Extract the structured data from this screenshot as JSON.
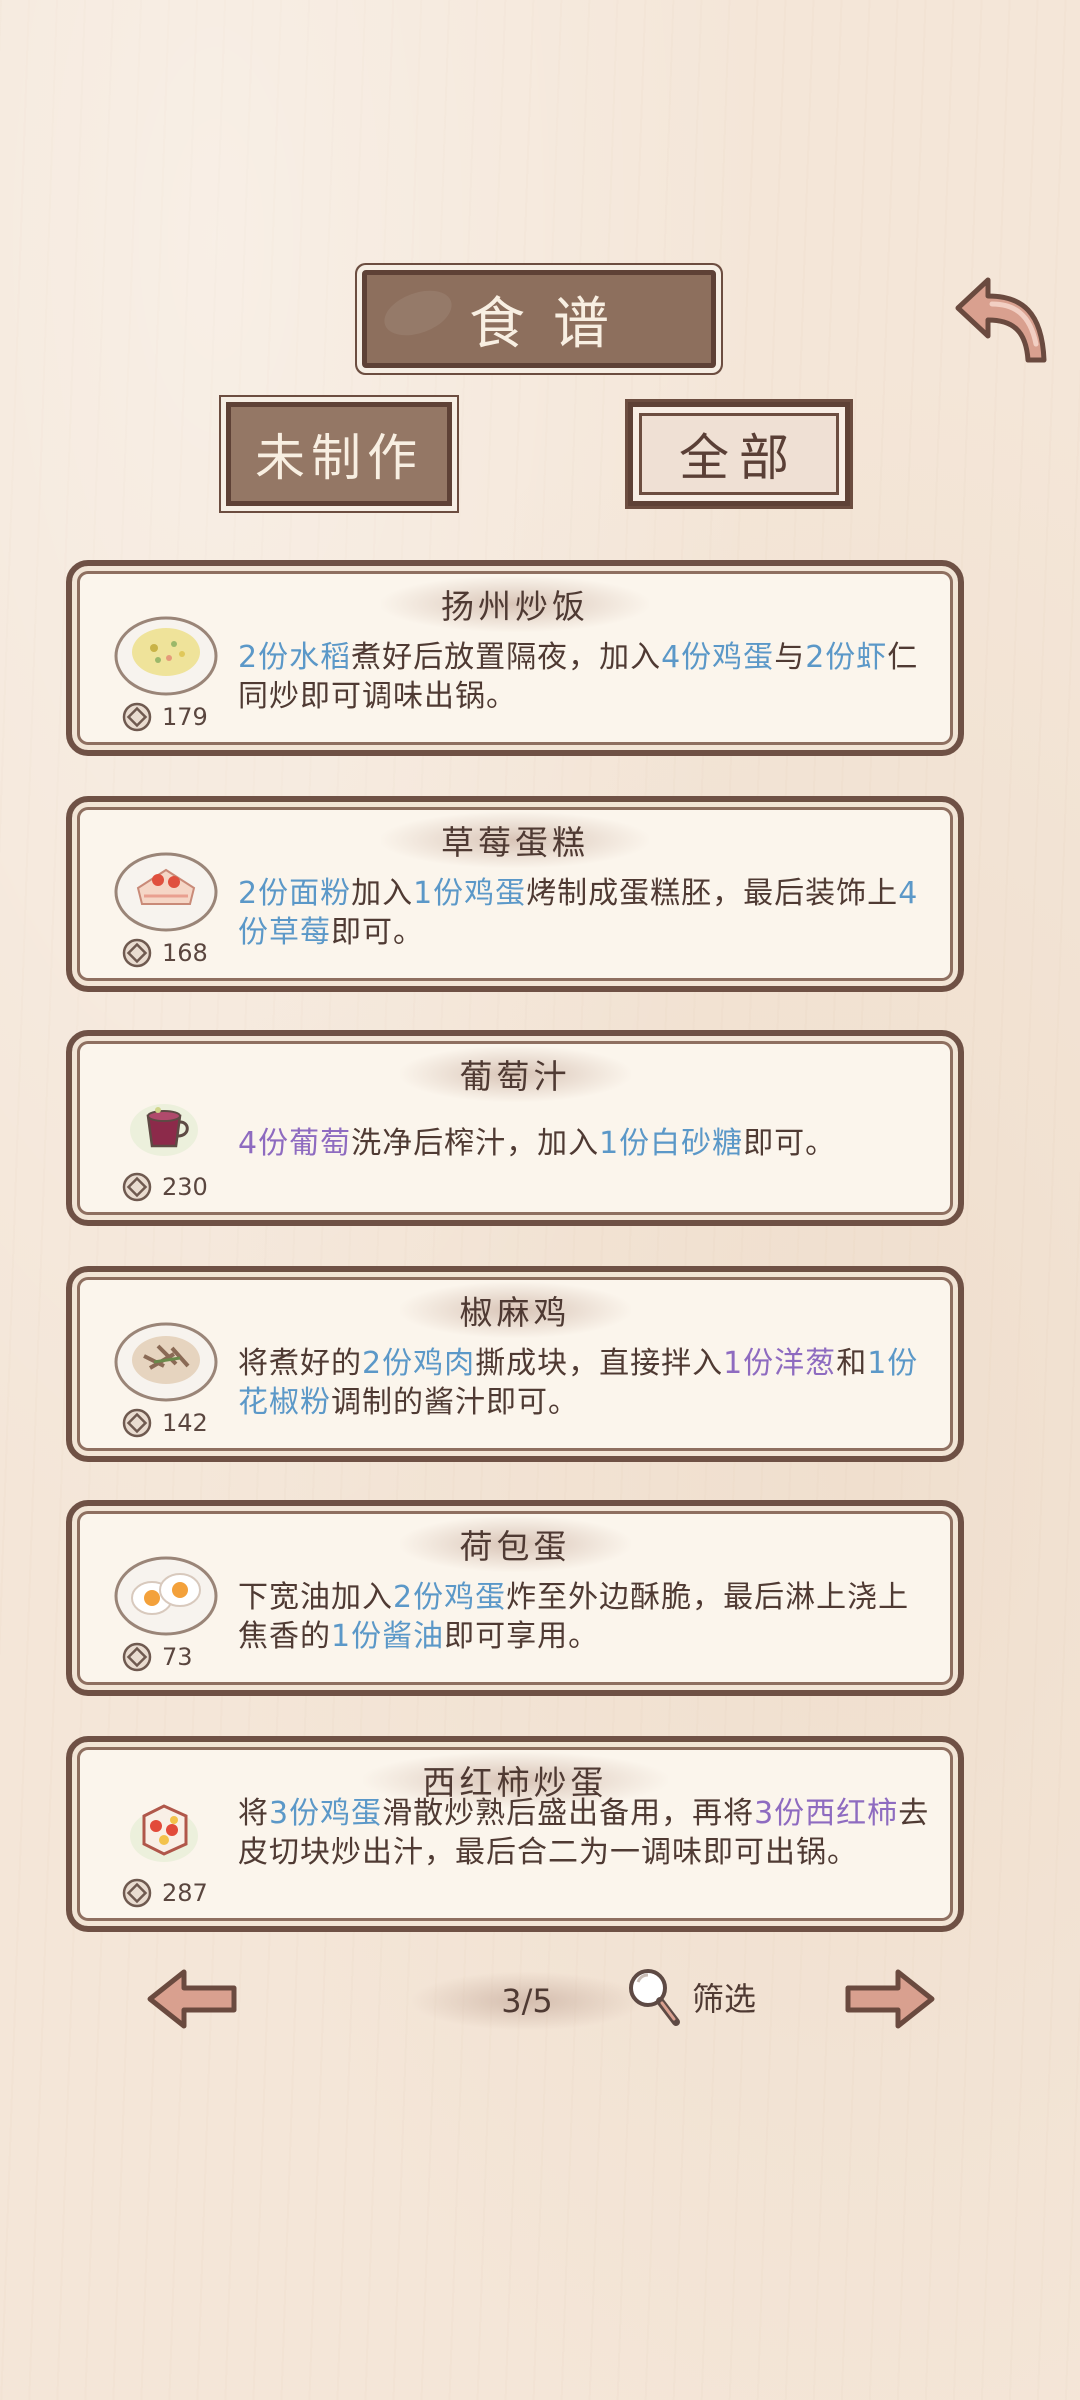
{
  "header": {
    "title": "食谱",
    "back_icon": "back-arrow-icon"
  },
  "tabs": [
    {
      "label": "未制作",
      "active": false
    },
    {
      "label": "全部",
      "active": true
    }
  ],
  "recipes": [
    {
      "name": "扬州炒饭",
      "price": "179",
      "dish_icon": "fried-rice-icon",
      "segments": [
        {
          "text": "2份水稻",
          "type": "blue"
        },
        {
          "text": "煮好后放置隔夜，加入",
          "type": "plain"
        },
        {
          "text": "4份鸡蛋",
          "type": "blue"
        },
        {
          "text": "与",
          "type": "plain"
        },
        {
          "text": "2份虾",
          "type": "blue"
        },
        {
          "text": "仁同炒即可调味出锅。",
          "type": "plain"
        }
      ]
    },
    {
      "name": "草莓蛋糕",
      "price": "168",
      "dish_icon": "strawberry-cake-icon",
      "segments": [
        {
          "text": "2份面粉",
          "type": "blue"
        },
        {
          "text": "加入",
          "type": "plain"
        },
        {
          "text": "1份鸡蛋",
          "type": "blue"
        },
        {
          "text": "烤制成蛋糕胚，最后装饰上",
          "type": "plain"
        },
        {
          "text": "4份草莓",
          "type": "blue"
        },
        {
          "text": "即可。",
          "type": "plain"
        }
      ]
    },
    {
      "name": "葡萄汁",
      "price": "230",
      "dish_icon": "grape-juice-icon",
      "segments": [
        {
          "text": "4份葡萄",
          "type": "purple"
        },
        {
          "text": "洗净后榨汁，加入",
          "type": "plain"
        },
        {
          "text": "1份白砂糖",
          "type": "blue"
        },
        {
          "text": "即可。",
          "type": "plain"
        }
      ]
    },
    {
      "name": "椒麻鸡",
      "price": "142",
      "dish_icon": "pepper-chicken-icon",
      "segments": [
        {
          "text": "将煮好的",
          "type": "plain"
        },
        {
          "text": "2份鸡肉",
          "type": "blue"
        },
        {
          "text": "撕成块，直接拌入",
          "type": "plain"
        },
        {
          "text": "1份洋葱",
          "type": "purple"
        },
        {
          "text": "和",
          "type": "plain"
        },
        {
          "text": "1份花椒粉",
          "type": "blue"
        },
        {
          "text": "调制的酱汁即可。",
          "type": "plain"
        }
      ]
    },
    {
      "name": "荷包蛋",
      "price": "73",
      "dish_icon": "fried-egg-icon",
      "segments": [
        {
          "text": "下宽油加入",
          "type": "plain"
        },
        {
          "text": "2份鸡蛋",
          "type": "blue"
        },
        {
          "text": "炸至外边酥脆，最后淋上浇上焦香的",
          "type": "plain"
        },
        {
          "text": "1份酱油",
          "type": "blue"
        },
        {
          "text": "即可享用。",
          "type": "plain"
        }
      ]
    },
    {
      "name": "西红柿炒蛋",
      "price": "287",
      "dish_icon": "tomato-egg-icon",
      "segments": [
        {
          "text": "将",
          "type": "plain"
        },
        {
          "text": "3份鸡蛋",
          "type": "blue"
        },
        {
          "text": "滑散炒熟后盛出备用，再将",
          "type": "plain"
        },
        {
          "text": "3份西红柿",
          "type": "purple"
        },
        {
          "text": "去皮切块炒出汁，最后合二为一调味即可出锅。",
          "type": "plain"
        }
      ]
    }
  ],
  "pagination": {
    "page": "3/5",
    "filter_label": "筛选",
    "prev_icon": "left-arrow-icon",
    "next_icon": "right-arrow-icon",
    "filter_icon": "magnifier-icon"
  },
  "colors": {
    "ingredient_blue": "#5b98c8",
    "ingredient_purple": "#8e6bc0",
    "frame_brown": "#6f5145"
  }
}
